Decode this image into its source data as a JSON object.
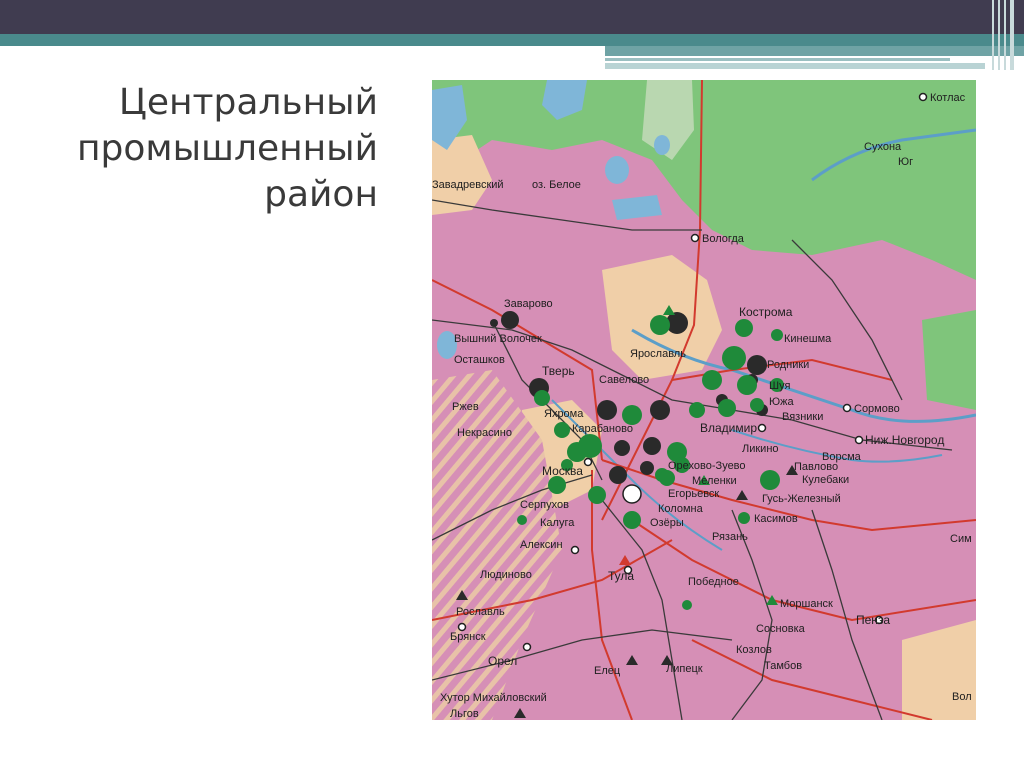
{
  "slide": {
    "title_lines": [
      "Центральный",
      "промышленный",
      "район"
    ]
  },
  "map": {
    "colors": {
      "industrial_region": "#d68fb6",
      "forest": "#7fc57b",
      "beige": "#f0cfa8",
      "water": "#7fb6d8",
      "rail": "#d23a2e",
      "road": "#3a3a3a",
      "green_dot": "#1f8a3a",
      "black_dot": "#2a2a2a"
    },
    "places": [
      {
        "id": "kotlas",
        "name": "Котлас"
      },
      {
        "id": "vologda",
        "name": "Вологда"
      },
      {
        "id": "kostroma",
        "name": "Кострома"
      },
      {
        "id": "kineshma",
        "name": "Кинешма"
      },
      {
        "id": "rodniki",
        "name": "Родники"
      },
      {
        "id": "shuya",
        "name": "Шуя"
      },
      {
        "id": "yuzha",
        "name": "Южа"
      },
      {
        "id": "vyazniki",
        "name": "Вязники"
      },
      {
        "id": "sormovo",
        "name": "Сормово"
      },
      {
        "id": "nizhny",
        "name": "Ниж.Новгород"
      },
      {
        "id": "vorsma",
        "name": "Ворсма"
      },
      {
        "id": "pavlovo",
        "name": "Павлово"
      },
      {
        "id": "kulebaki",
        "name": "Кулебаки"
      },
      {
        "id": "gus",
        "name": "Гусь-Железный"
      },
      {
        "id": "kasimov",
        "name": "Касимов"
      },
      {
        "id": "zavarovo",
        "name": "Заварово"
      },
      {
        "id": "vyshny",
        "name": "Вышний Волочек"
      },
      {
        "id": "ostashkov",
        "name": "Осташков"
      },
      {
        "id": "tver",
        "name": "Тверь"
      },
      {
        "id": "yaroslavl",
        "name": "Ярославль"
      },
      {
        "id": "savelovo",
        "name": "Савелово"
      },
      {
        "id": "yakhroma",
        "name": "Яхрома"
      },
      {
        "id": "karabanovo",
        "name": "Карабаново"
      },
      {
        "id": "vladimir",
        "name": "Владимир"
      },
      {
        "id": "likino",
        "name": "Ликино"
      },
      {
        "id": "nekrasino",
        "name": "Некрасино"
      },
      {
        "id": "moskva",
        "name": "Москва"
      },
      {
        "id": "orekhovo",
        "name": "Орехово-Зуево"
      },
      {
        "id": "melenki",
        "name": "Меленки"
      },
      {
        "id": "egoryevsk",
        "name": "Егорьевск"
      },
      {
        "id": "kolomna",
        "name": "Коломна"
      },
      {
        "id": "ozyory",
        "name": "Озёры"
      },
      {
        "id": "serpukhov",
        "name": "Серпухов"
      },
      {
        "id": "kaluga",
        "name": "Калуга"
      },
      {
        "id": "aleksin",
        "name": "Алексин"
      },
      {
        "id": "ryazan",
        "name": "Рязань"
      },
      {
        "id": "rzhev",
        "name": "Ржев"
      },
      {
        "id": "lyudinovo",
        "name": "Людиново"
      },
      {
        "id": "tula",
        "name": "Тула"
      },
      {
        "id": "pobednoe",
        "name": "Победное"
      },
      {
        "id": "morshansk",
        "name": "Моршанск"
      },
      {
        "id": "sosnovka",
        "name": "Сосновка"
      },
      {
        "id": "penza",
        "name": "Пенза"
      },
      {
        "id": "roslavl",
        "name": "Рославль"
      },
      {
        "id": "bryansk",
        "name": "Брянск"
      },
      {
        "id": "orel",
        "name": "Орел"
      },
      {
        "id": "elets",
        "name": "Елец"
      },
      {
        "id": "lipetsk",
        "name": "Липецк"
      },
      {
        "id": "kozlov",
        "name": "Козлов"
      },
      {
        "id": "tambov",
        "name": "Тамбов"
      },
      {
        "id": "khutor",
        "name": "Хутор Михайловский"
      },
      {
        "id": "lgov",
        "name": "Льгов"
      },
      {
        "id": "beloe",
        "name": "оз. Белое"
      },
      {
        "id": "sukhona",
        "name": "Сухона"
      },
      {
        "id": "yug",
        "name": "Юг"
      },
      {
        "id": "zavadrevsky",
        "name": "Завадревский"
      },
      {
        "id": "sim",
        "name": "Сим"
      },
      {
        "id": "vol",
        "name": "Вол"
      }
    ]
  }
}
